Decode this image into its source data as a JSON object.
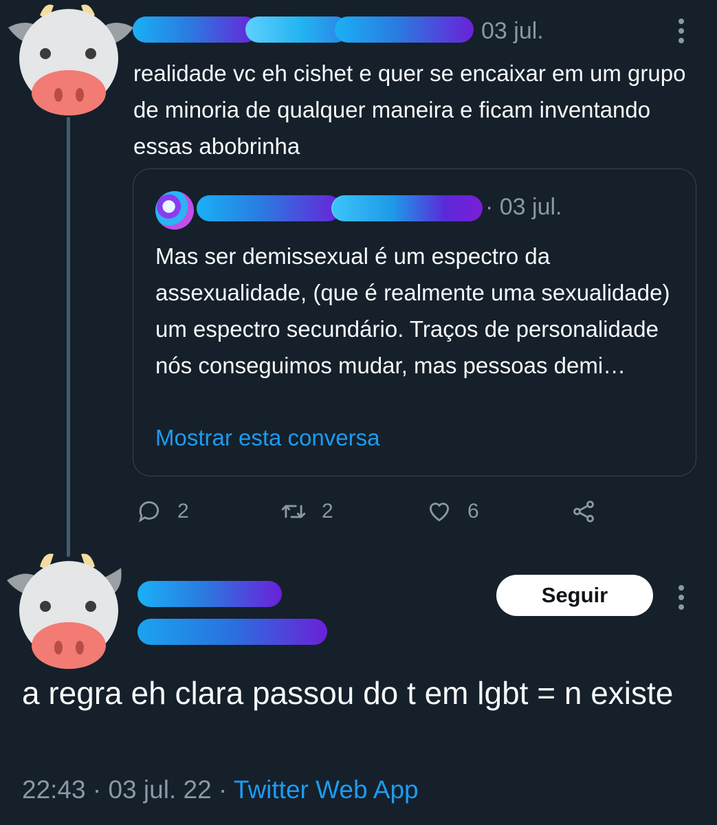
{
  "reply_tweet": {
    "date": "03 jul.",
    "text": "realidade vc eh cishet e quer se encaixar em um grupo de minoria de qualquer maneira e ficam inventando essas abobrinha",
    "quote": {
      "date": "· 03 jul.",
      "text": "Mas ser demissexual é um espectro da assexualidade, (que é realmente uma sexualidade) um espectro secundário. Traços de personalidade nós conseguimos mudar, mas pessoas demi…",
      "show_conversation": "Mostrar esta conversa"
    },
    "actions": {
      "reply_count": "2",
      "retweet_count": "2",
      "like_count": "6"
    }
  },
  "main_tweet": {
    "follow_label": "Seguir",
    "text": "a regra eh clara passou do t em lgbt = n existe",
    "time": "22:43",
    "separator": "·",
    "date": "03 jul. 22",
    "app": "Twitter Web App"
  },
  "icons": {
    "avatar": "cow-emoji",
    "more": "more-vertical-icon",
    "reply": "reply-icon",
    "retweet": "retweet-icon",
    "like": "heart-icon",
    "share": "share-icon"
  },
  "colors": {
    "background": "#15202b",
    "text": "#f7f9f9",
    "muted": "#8b98a5",
    "link": "#1d9bf0",
    "border": "#38444d",
    "thread_line": "#425c72"
  }
}
